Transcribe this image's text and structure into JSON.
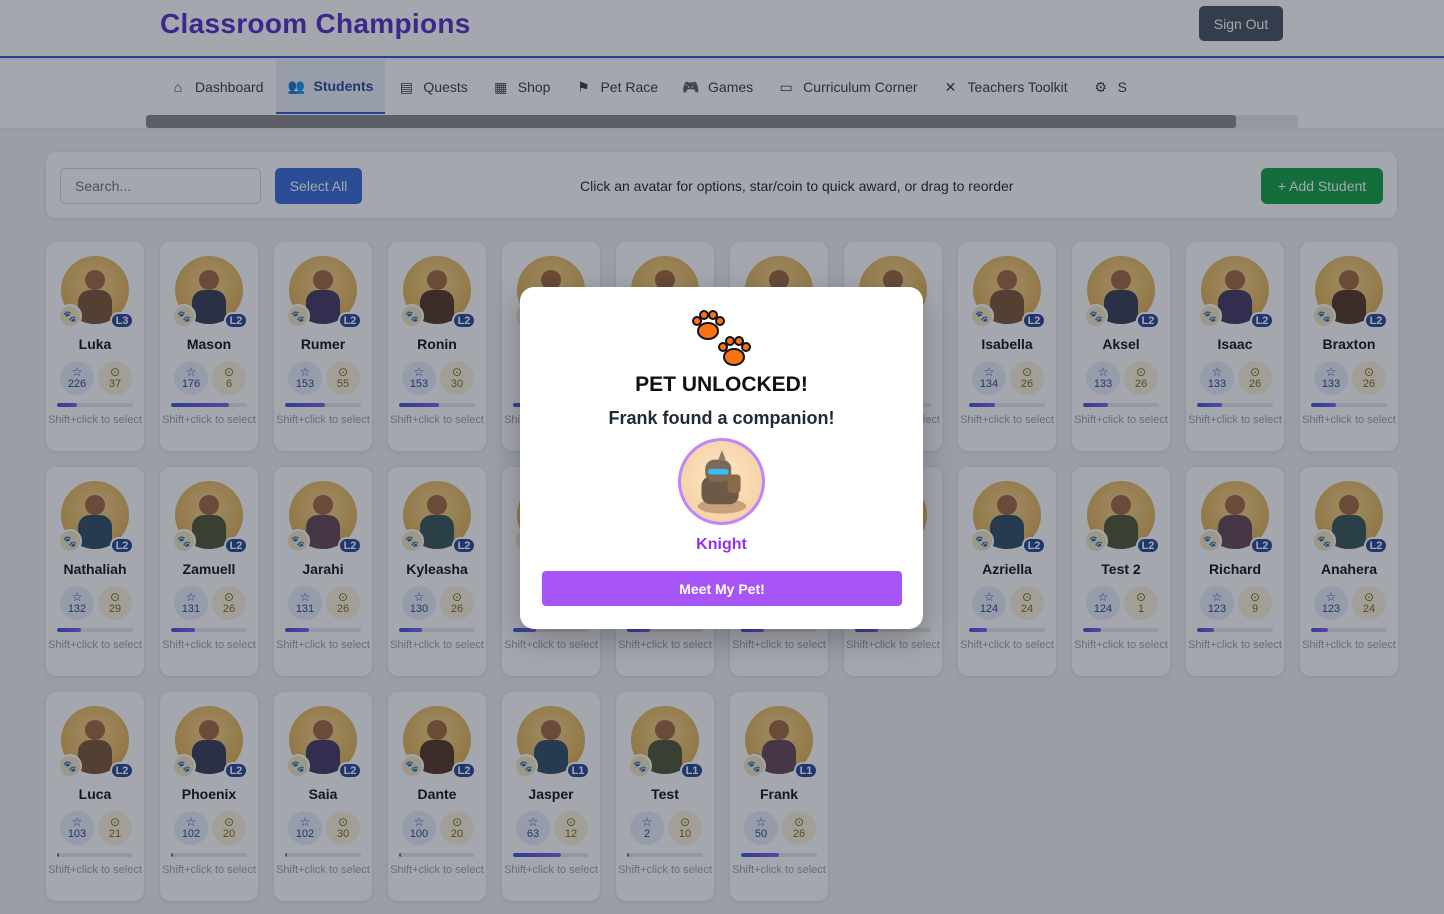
{
  "app": {
    "title": "Classroom Champions",
    "sign_out_label": "Sign Out"
  },
  "nav": {
    "tabs": [
      {
        "label": "Dashboard",
        "icon": "house-icon",
        "active": false
      },
      {
        "label": "Students",
        "icon": "users-icon",
        "active": true
      },
      {
        "label": "Quests",
        "icon": "scroll-icon",
        "active": false
      },
      {
        "label": "Shop",
        "icon": "shop-icon",
        "active": false
      },
      {
        "label": "Pet Race",
        "icon": "flag-icon",
        "active": false
      },
      {
        "label": "Games",
        "icon": "gamepad-icon",
        "active": false
      },
      {
        "label": "Curriculum Corner",
        "icon": "book-icon",
        "active": false
      },
      {
        "label": "Teachers Toolkit",
        "icon": "tools-icon",
        "active": false
      },
      {
        "label": "S",
        "icon": "gear-icon",
        "active": false
      }
    ]
  },
  "toolbar": {
    "search_placeholder": "Search...",
    "select_all_label": "Select All",
    "hint": "Click an avatar for options, star/coin to quick award, or drag to reorder",
    "add_student_label": "+ Add Student"
  },
  "card_hint": "Shift+click to select",
  "students": [
    {
      "name": "Luka",
      "level": "L3",
      "xp": 226,
      "coins": 37,
      "progress": 0.26,
      "hidden": false
    },
    {
      "name": "Mason",
      "level": "L2",
      "xp": 176,
      "coins": 6,
      "progress": 0.76,
      "hidden": false
    },
    {
      "name": "Rumer",
      "level": "L2",
      "xp": 153,
      "coins": 55,
      "progress": 0.53,
      "hidden": false
    },
    {
      "name": "Ronin",
      "level": "L2",
      "xp": 153,
      "coins": 30,
      "progress": 0.53,
      "hidden": false
    },
    {
      "name": "",
      "level": "",
      "xp": null,
      "coins": null,
      "progress": 0.5,
      "hidden": true
    },
    {
      "name": "",
      "level": "",
      "xp": null,
      "coins": null,
      "progress": 0.5,
      "hidden": true
    },
    {
      "name": "",
      "level": "",
      "xp": null,
      "coins": null,
      "progress": 0.5,
      "hidden": true
    },
    {
      "name": "",
      "level": "",
      "xp": null,
      "coins": null,
      "progress": 0.5,
      "hidden": true
    },
    {
      "name": "Isabella",
      "level": "L2",
      "xp": 134,
      "coins": 26,
      "progress": 0.34,
      "hidden": false
    },
    {
      "name": "Aksel",
      "level": "L2",
      "xp": 133,
      "coins": 26,
      "progress": 0.33,
      "hidden": false
    },
    {
      "name": "Isaac",
      "level": "L2",
      "xp": 133,
      "coins": 26,
      "progress": 0.33,
      "hidden": false
    },
    {
      "name": "Braxton",
      "level": "L2",
      "xp": 133,
      "coins": 26,
      "progress": 0.33,
      "hidden": false
    },
    {
      "name": "Nathaliah",
      "level": "L2",
      "xp": 132,
      "coins": 29,
      "progress": 0.32,
      "hidden": false
    },
    {
      "name": "Zamuell",
      "level": "L2",
      "xp": 131,
      "coins": 26,
      "progress": 0.31,
      "hidden": false
    },
    {
      "name": "Jarahi",
      "level": "L2",
      "xp": 131,
      "coins": 26,
      "progress": 0.31,
      "hidden": false
    },
    {
      "name": "Kyleasha",
      "level": "L2",
      "xp": 130,
      "coins": 26,
      "progress": 0.3,
      "hidden": false
    },
    {
      "name": "",
      "level": "",
      "xp": null,
      "coins": null,
      "progress": 0.3,
      "hidden": true
    },
    {
      "name": "",
      "level": "",
      "xp": null,
      "coins": null,
      "progress": 0.3,
      "hidden": true
    },
    {
      "name": "",
      "level": "",
      "xp": null,
      "coins": null,
      "progress": 0.3,
      "hidden": true
    },
    {
      "name": "",
      "level": "",
      "xp": null,
      "coins": null,
      "progress": 0.3,
      "hidden": true
    },
    {
      "name": "Azriella",
      "level": "L2",
      "xp": 124,
      "coins": 24,
      "progress": 0.24,
      "hidden": false
    },
    {
      "name": "Test 2",
      "level": "L2",
      "xp": 124,
      "coins": 1,
      "progress": 0.24,
      "hidden": false
    },
    {
      "name": "Richard",
      "level": "L2",
      "xp": 123,
      "coins": 9,
      "progress": 0.23,
      "hidden": false
    },
    {
      "name": "Anahera",
      "level": "L2",
      "xp": 123,
      "coins": 24,
      "progress": 0.23,
      "hidden": false
    },
    {
      "name": "Luca",
      "level": "L2",
      "xp": 103,
      "coins": 21,
      "progress": 0.03,
      "hidden": false
    },
    {
      "name": "Phoenix",
      "level": "L2",
      "xp": 102,
      "coins": 20,
      "progress": 0.02,
      "hidden": false
    },
    {
      "name": "Saia",
      "level": "L2",
      "xp": 102,
      "coins": 30,
      "progress": 0.02,
      "hidden": false
    },
    {
      "name": "Dante",
      "level": "L2",
      "xp": 100,
      "coins": 20,
      "progress": 0.0,
      "hidden": false
    },
    {
      "name": "Jasper",
      "level": "L1",
      "xp": 63,
      "coins": 12,
      "progress": 0.63,
      "hidden": false
    },
    {
      "name": "Test",
      "level": "L1",
      "xp": 2,
      "coins": 10,
      "progress": 0.02,
      "hidden": false
    },
    {
      "name": "Frank",
      "level": "L1",
      "xp": 50,
      "coins": 26,
      "progress": 0.5,
      "hidden": false
    }
  ],
  "modal": {
    "icon": "paw-prints-icon",
    "title": "PET UNLOCKED!",
    "subtitle": "Frank found a companion!",
    "pet_name": "Knight",
    "button_label": "Meet My Pet!"
  },
  "colors": {
    "brand": "#5b2fc9",
    "primary": "#3a6fd8",
    "success": "#16a34a",
    "pet_accent": "#a855f7"
  }
}
